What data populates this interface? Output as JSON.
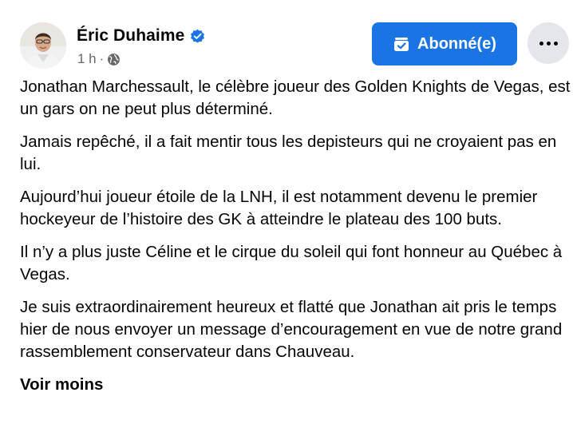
{
  "post": {
    "author": "Éric Duhaime",
    "verified_icon": "verified-badge-icon",
    "timestamp": "1 h",
    "separator": "·",
    "audience_icon": "globe-icon",
    "follow_button": "Abonné(e)",
    "follow_icon": "following-check-icon",
    "more_icon": "more-options-icon",
    "paragraphs": [
      "Jonathan Marchessault, le célèbre joueur des Golden Knights de Vegas, est un gars on ne peut plus déterminé.",
      "Jamais repêché, il a fait mentir tous les depisteurs qui ne croyaient pas en lui.",
      "Aujourd’hui joueur étoile de la LNH, il est notamment devenu le premier hockeyeur de l’histoire des GK à atteindre le plateau des 100 buts.",
      "Il n’y a plus juste Céline et le cirque du soleil qui font honneur au Québec à Vegas.",
      "Je suis extraordinairement heureux et flatté que Jonathan ait pris le temps hier de nous envoyer un message d’encouragement en vue de notre grand rassemblement conservateur dans Chauveau."
    ],
    "see_less": "Voir moins"
  },
  "colors": {
    "primary_blue": "#1b74e4",
    "secondary_text": "#65676b",
    "button_gray": "#e4e6eb"
  }
}
